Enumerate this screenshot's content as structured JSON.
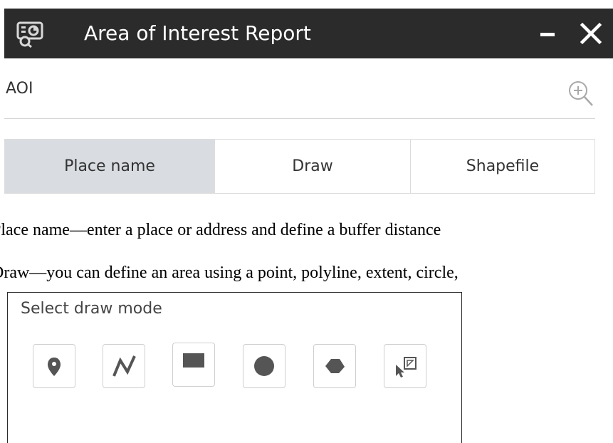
{
  "header": {
    "title": "Area of Interest Report"
  },
  "aoi": {
    "label": "AOI"
  },
  "tabs": [
    {
      "label": "Place name",
      "active": true
    },
    {
      "label": "Draw",
      "active": false
    },
    {
      "label": "Shapefile",
      "active": false
    }
  ],
  "doc": {
    "place_name_text": "Place name—enter a place or address and define a buffer distance",
    "draw_text": "Draw—you can define an area using a point, polyline, extent, circle,"
  },
  "draw_panel": {
    "title": "Select draw mode",
    "modes": [
      "point",
      "polyline",
      "extent",
      "circle",
      "polygon",
      "select-feature"
    ]
  },
  "colors": {
    "titlebar_bg": "#2b2b2b",
    "active_tab_bg": "#d9dde2",
    "icon_gray": "#555555"
  }
}
